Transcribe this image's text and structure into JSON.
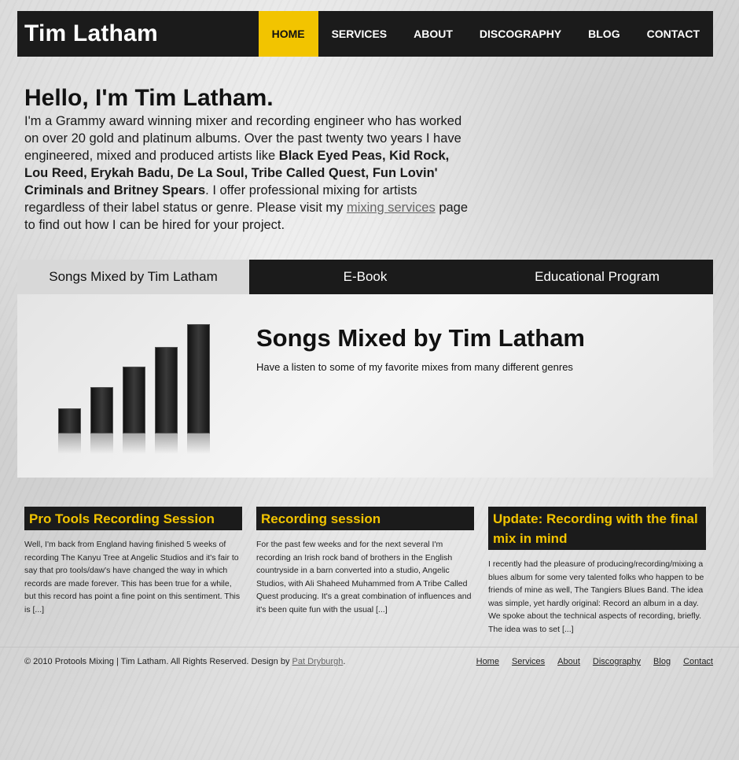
{
  "header": {
    "logo": "Tim Latham",
    "nav": [
      "HOME",
      "SERVICES",
      "ABOUT",
      "DISCOGRAPHY",
      "BLOG",
      "CONTACT"
    ]
  },
  "intro": {
    "heading": "Hello, I'm Tim Latham.",
    "text_1": "I'm a Grammy award winning mixer and recording engineer who has worked on over 20 gold and platinum albums. Over the past twenty two years I have engineered, mixed and produced artists like ",
    "artists": "Black Eyed Peas, Kid Rock, Lou Reed, Erykah Badu, De La Soul, Tribe Called Quest, Fun Lovin' Criminals and Britney Spears",
    "text_2": ". I offer professional mixing for artists regardless of their label status or genre. Please visit my ",
    "link": "mixing services",
    "text_3": " page to find out how I can be hired for your project."
  },
  "tabs": [
    "Songs Mixed by Tim Latham",
    "E-Book",
    "Educational Program"
  ],
  "panel": {
    "title": "Songs Mixed by Tim Latham",
    "subtitle": "Have a listen to some of my favorite mixes from many different genres",
    "bar_levels": [
      0.2,
      0.37,
      0.53,
      0.69,
      0.87
    ]
  },
  "posts": [
    {
      "title": "Pro Tools Recording Session",
      "body": "Well, I'm back from England having finished 5 weeks of recording The Kanyu Tree at Angelic Studios and it's fair to say that pro tools/daw's have changed the way in which records are made forever.  This has been true for a while, but this record has point a fine point on this sentiment.  This is [...]"
    },
    {
      "title": "Recording session",
      "body": "For the past few weeks and for the next several I'm recording an Irish rock band of brothers in the English countryside in a barn converted into a studio, Angelic Studios, with Ali Shaheed Muhammed from A Tribe Called Quest producing. It's a great combination of influences and it's been quite fun with the usual [...]"
    },
    {
      "title": "Update: Recording with the final mix in mind",
      "body": "I recently had the pleasure of producing/recording/mixing a blues album for some very talented folks who happen to be friends of mine as well, The Tangiers Blues Band. The idea was simple, yet hardly original: Record an album in a day. We spoke about the technical aspects of recording, briefly. The idea was to set [...]"
    }
  ],
  "footer": {
    "copyright": "© 2010 Protools Mixing | Tim Latham. All Rights Reserved. Design by ",
    "designer": "Pat Dryburgh",
    "period": ".",
    "nav": [
      "Home",
      "Services",
      "About",
      "Discography",
      "Blog",
      "Contact"
    ]
  },
  "colors": {
    "accent": "#f2c400",
    "dark": "#1b1b1b"
  }
}
